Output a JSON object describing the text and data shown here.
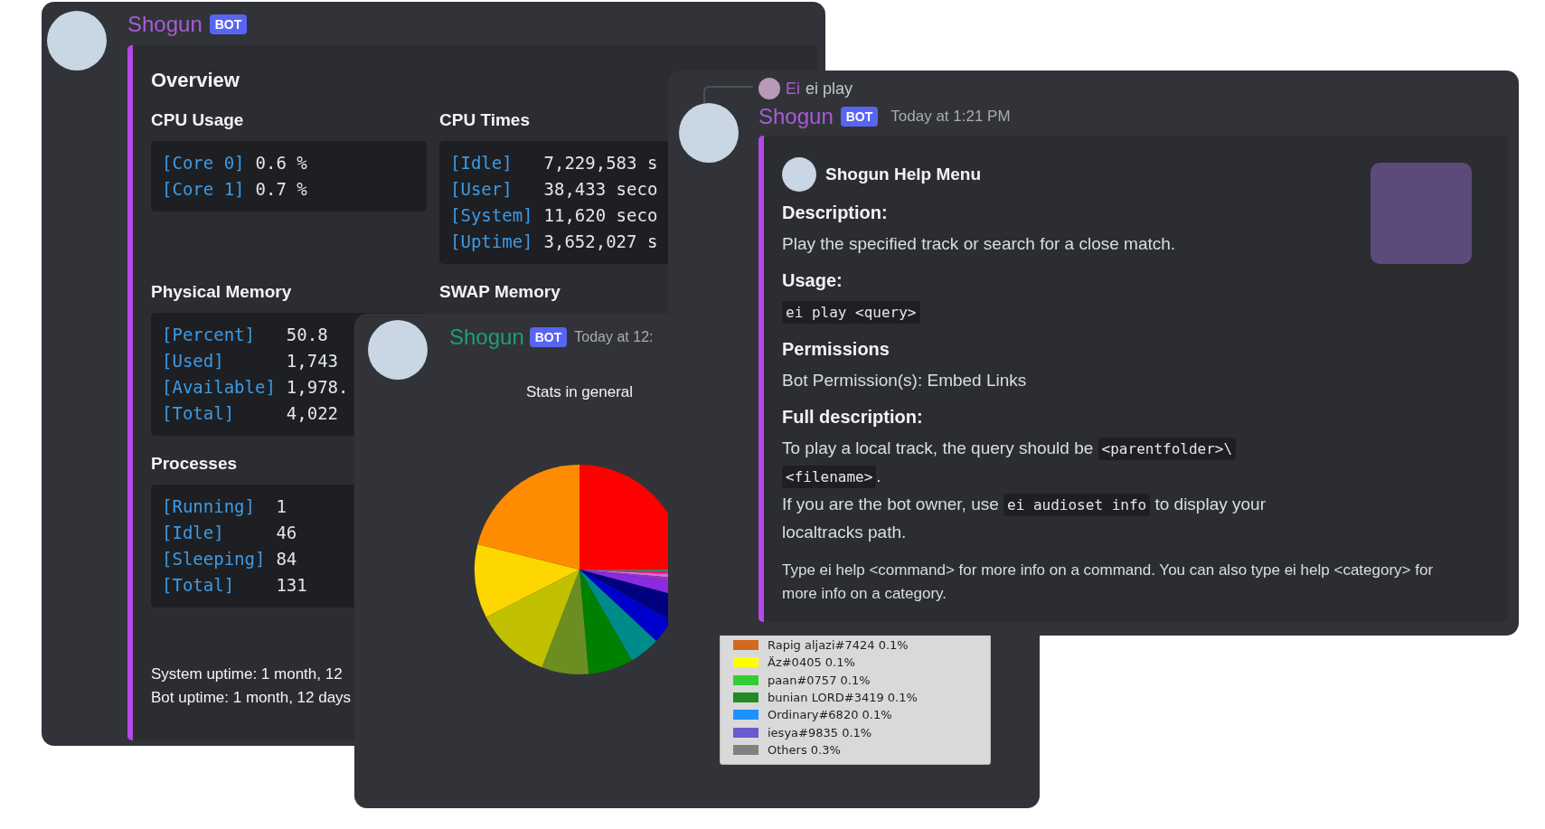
{
  "stats_window": {
    "bot_name": "Shogun",
    "badge": "BOT",
    "embed": {
      "title": "Overview",
      "fields": [
        {
          "name": "CPU Usage",
          "rows": [
            {
              "key": "[Core 0]",
              "value": "0.6 %"
            },
            {
              "key": "[Core 1]",
              "value": "0.7 %"
            }
          ]
        },
        {
          "name": "CPU Times",
          "rows": [
            {
              "key": "[Idle]",
              "value": "7,229,583 s"
            },
            {
              "key": "[User]",
              "value": "38,433 seco"
            },
            {
              "key": "[System]",
              "value": "11,620 seco"
            },
            {
              "key": "[Uptime]",
              "value": "3,652,027 s"
            }
          ]
        },
        {
          "name": "Physical Memory",
          "rows": [
            {
              "key": "[Percent]",
              "value": "50.8"
            },
            {
              "key": "[Used]",
              "value": "1,743"
            },
            {
              "key": "[Available]",
              "value": "1,978."
            },
            {
              "key": "[Total]",
              "value": "4,022"
            }
          ]
        },
        {
          "name": "SWAP Memory"
        },
        {
          "name": "Processes",
          "rows": [
            {
              "key": "[Running]",
              "value": "1"
            },
            {
              "key": "[Idle]",
              "value": "46"
            },
            {
              "key": "[Sleeping]",
              "value": "84"
            },
            {
              "key": "[Total]",
              "value": "131"
            }
          ]
        }
      ],
      "footer": [
        "System uptime: 1 month, 12",
        "Bot uptime: 1 month, 12 days"
      ]
    }
  },
  "chart_window": {
    "bot_name": "Shogun",
    "badge": "BOT",
    "timestamp": "Today at 12:",
    "chart_title": "Stats in general",
    "legend": [
      {
        "label": "Rapig aljazi#7424 0.1%",
        "color": "#d2691e"
      },
      {
        "label": "Äz#0405 0.1%",
        "color": "#ffff00"
      },
      {
        "label": "paan#0757 0.1%",
        "color": "#32cd32"
      },
      {
        "label": "bunian LORD#3419 0.1%",
        "color": "#228b22"
      },
      {
        "label": "Ordinary#6820 0.1%",
        "color": "#1e90ff"
      },
      {
        "label": "iesya#9835 0.1%",
        "color": "#6a5acd"
      },
      {
        "label": "Others 0.3%",
        "color": "#808080"
      }
    ]
  },
  "help_window": {
    "reply": {
      "author": "Ei",
      "content": "ei play"
    },
    "bot_name": "Shogun",
    "badge": "BOT",
    "timestamp": "Today at 1:21 PM",
    "embed": {
      "author": "Shogun Help Menu",
      "fields": [
        {
          "name": "Description:",
          "lines": [
            [
              {
                "kind": "text",
                "text": "Play the specified track or search for a close match."
              }
            ]
          ]
        },
        {
          "name": "Usage:",
          "lines": [
            [
              {
                "kind": "code",
                "text": "ei play <query>"
              }
            ]
          ]
        },
        {
          "name": "Permissions",
          "lines": [
            [
              {
                "kind": "text",
                "text": "Bot Permission(s): Embed Links"
              }
            ]
          ]
        },
        {
          "name": "Full description:",
          "lines": [
            [
              {
                "kind": "text",
                "text": "To play a local track, the query should be "
              },
              {
                "kind": "code",
                "text": "<parentfolder>\\"
              }
            ],
            [
              {
                "kind": "code",
                "text": "<filename>"
              },
              {
                "kind": "text",
                "text": "."
              }
            ],
            [
              {
                "kind": "text",
                "text": "If you are the bot owner, use "
              },
              {
                "kind": "code",
                "text": "ei audioset info"
              },
              {
                "kind": "text",
                "text": " to display your"
              }
            ],
            [
              {
                "kind": "text",
                "text": "localtracks path."
              }
            ]
          ]
        }
      ],
      "footer": "Type ei help <command> for more info on a command. You can also type ei help <category> for more info on a category."
    }
  }
}
